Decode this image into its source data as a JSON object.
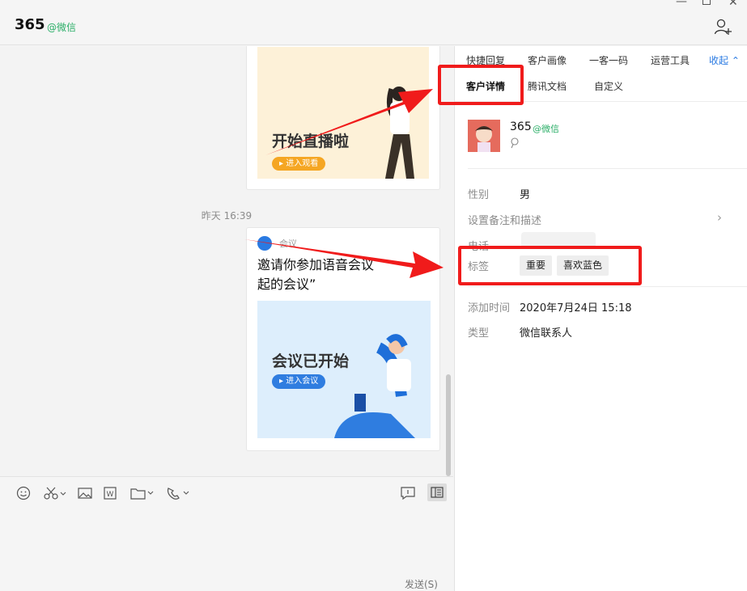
{
  "header": {
    "title": "365",
    "subtitle": "@微信"
  },
  "chat": {
    "card1": {
      "banner_title": "开始直播啦",
      "banner_button": "进入观看"
    },
    "timestamp": "昨天 16:39",
    "card2": {
      "app_name": "会议",
      "message": "邀请你参加语音会议\n起的会议”",
      "banner_title": "会议已开始",
      "banner_button": "进入会议"
    }
  },
  "input": {
    "send_label": "发送(S)"
  },
  "panel": {
    "tabs_row1": [
      "快捷回复",
      "客户画像",
      "一客一码",
      "运营工具"
    ],
    "collapse_label": "收起",
    "tabs_row2": [
      "客户详情",
      "腾讯文档",
      "自定义"
    ],
    "contact": {
      "name": "365",
      "source": "@微信"
    },
    "fields": {
      "gender_label": "性别",
      "gender_value": "男",
      "remark_label": "设置备注和描述",
      "phone_label": "电话",
      "tags_label": "标签",
      "tags": [
        "重要",
        "喜欢蓝色"
      ],
      "added_label": "添加时间",
      "added_value": "2020年7月24日 15:18",
      "type_label": "类型",
      "type_value": "微信联系人"
    }
  },
  "colors": {
    "accent_green": "#2aae67",
    "accent_blue": "#2a7ae2",
    "annotation_red": "#f01b1b"
  }
}
